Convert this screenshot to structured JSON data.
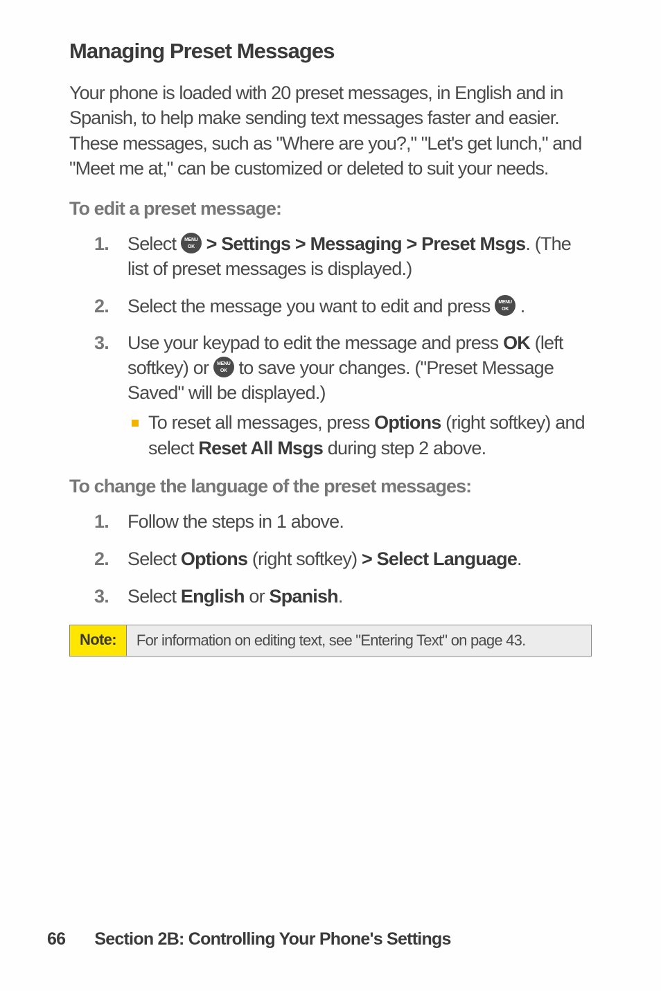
{
  "heading": "Managing Preset Messages",
  "intro": "Your phone is loaded with 20 preset messages, in English and in Spanish, to help make sending text messages faster and easier. These messages, such as \"Where are you?,\" \"Let's get lunch,\" and \"Meet me at,\" can be customized or deleted to suit your needs.",
  "subhead1": "To edit a preset message:",
  "steps1": {
    "s1": {
      "prefix": "Select ",
      "bold": " > Settings > Messaging > Preset Msgs",
      "after_bold": ". (The list of preset messages is displayed.)"
    },
    "s2": {
      "prefix": "Select the message you want to edit and press ",
      "suffix": " ."
    },
    "s3": {
      "line_a_prefix": "Use your keypad to edit the message and press ",
      "ok": "OK",
      "line_a_mid": " (left softkey) or ",
      "line_a_suffix": " to save your changes. (\"Preset Message Saved\" will be displayed.)",
      "bullet_prefix": "To reset all messages, press ",
      "options": "Options",
      "bullet_mid": " (right softkey) and select ",
      "reset": "Reset All Msgs",
      "bullet_suffix": " during step 2 above."
    }
  },
  "subhead2": "To change the language of the preset messages:",
  "steps2": {
    "s1": "Follow the steps in 1 above.",
    "s2": {
      "prefix": "Select ",
      "options": "Options",
      "mid": " (right softkey) ",
      "bold": "> Select Language",
      "suffix": "."
    },
    "s3": {
      "prefix": "Select ",
      "english": "English",
      "or": " or ",
      "spanish": "Spanish",
      "suffix": "."
    }
  },
  "note": {
    "label": "Note:",
    "body": "For information on editing text, see \"Entering Text\" on page 43."
  },
  "footer": {
    "page": "66",
    "section": "Section 2B: Controlling Your Phone's Settings"
  }
}
